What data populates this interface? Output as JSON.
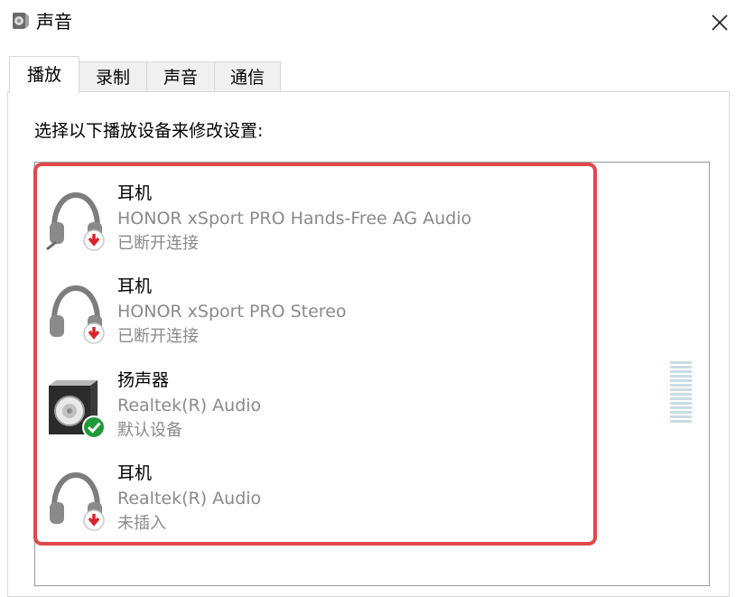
{
  "window": {
    "title": "声音",
    "title_icon": "speaker-icon",
    "close_icon": "close-icon"
  },
  "tabs": [
    {
      "label": "播放",
      "active": true
    },
    {
      "label": "录制",
      "active": false
    },
    {
      "label": "声音",
      "active": false
    },
    {
      "label": "通信",
      "active": false
    }
  ],
  "playback": {
    "instruction": "选择以下播放设备来修改设置:",
    "devices": [
      {
        "name": "耳机",
        "description": "HONOR xSport PRO Hands-Free AG Audio",
        "status": "已断开连接",
        "icon": "headphones-icon",
        "badge": "disconnected-arrow-icon"
      },
      {
        "name": "耳机",
        "description": "HONOR xSport PRO Stereo",
        "status": "已断开连接",
        "icon": "headphones-icon",
        "badge": "disconnected-arrow-icon"
      },
      {
        "name": "扬声器",
        "description": "Realtek(R) Audio",
        "status": "默认设备",
        "icon": "speaker-device-icon",
        "badge": "default-check-icon"
      },
      {
        "name": "耳机",
        "description": "Realtek(R) Audio",
        "status": "未插入",
        "icon": "headphones-icon",
        "badge": "unplugged-arrow-icon"
      }
    ]
  },
  "colors": {
    "highlight_border": "#e0484b",
    "badge_red": "#d9232a",
    "badge_green": "#1f9a3a",
    "secondary_text": "#8a8a8a"
  }
}
